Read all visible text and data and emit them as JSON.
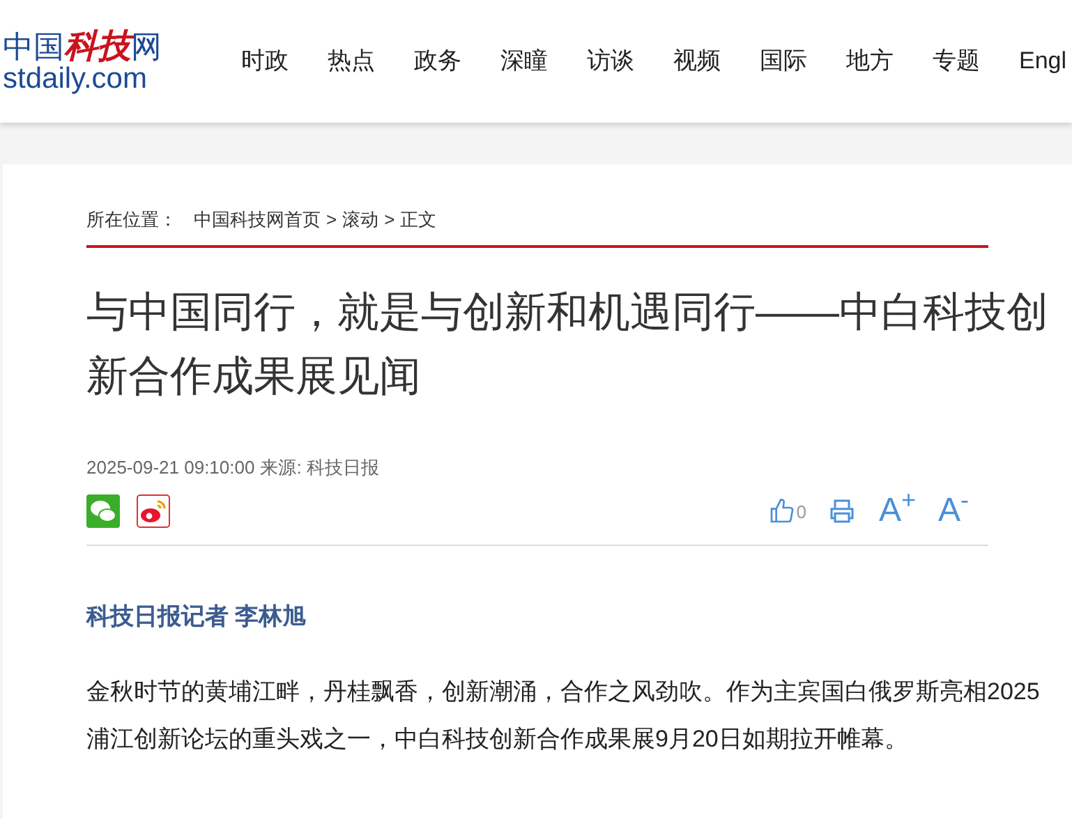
{
  "header": {
    "logo": {
      "cn_left": "中国",
      "cn_art": "科技",
      "cn_right": "网",
      "domain": "stdaily.com"
    },
    "nav": [
      "时政",
      "热点",
      "政务",
      "深瞳",
      "访谈",
      "视频",
      "国际",
      "地方",
      "专题",
      "Engl"
    ]
  },
  "article": {
    "breadcrumb": {
      "label": "所在位置：",
      "links": [
        "中国科技网首页",
        "滚动",
        "正文"
      ],
      "separator": ">"
    },
    "title": "与中国同行，就是与创新和机遇同行——中白科技创新合作成果展见闻",
    "date": "2025-09-21 09:10:00",
    "source": "来源: 科技日报",
    "like_count": "0",
    "font_up": "A$^{+}$",
    "font_down": "A$^{-}$",
    "author": "科技日报记者 李林旭",
    "paragraph": "金秋时节的黄埔江畔，丹桂飘香，创新潮涌，合作之风劲吹。作为主宾国白俄罗斯亮相2025浦江创新论坛的重头戏之一，中白科技创新合作成果展9月20日如期拉开帷幕。"
  }
}
